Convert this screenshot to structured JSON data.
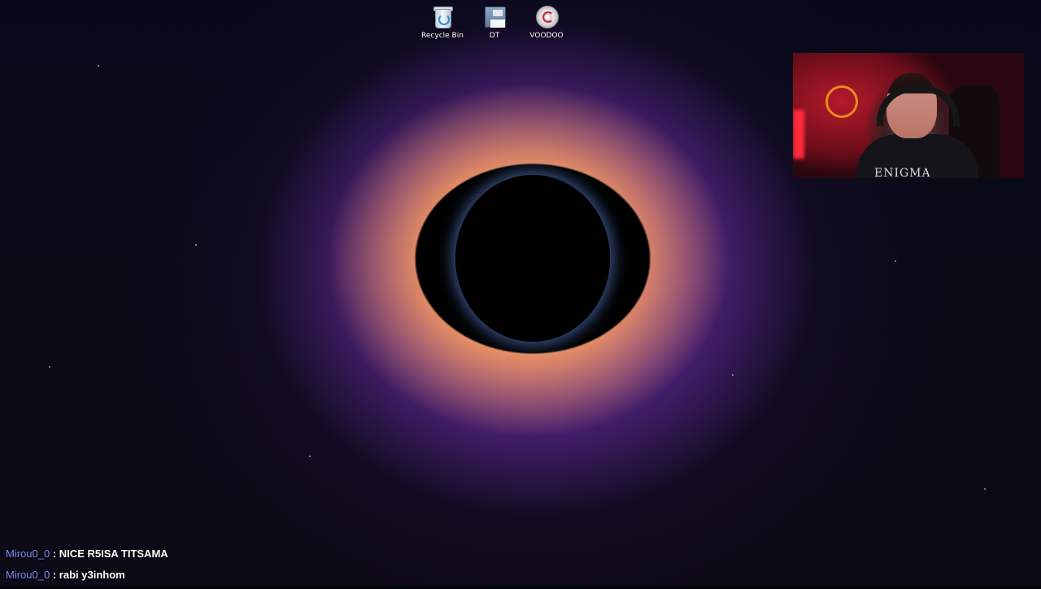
{
  "desktop": {
    "icons": [
      {
        "label": "Recycle Bin",
        "icon": "recycle-bin-icon"
      },
      {
        "label": "DT",
        "icon": "floppy-disk-icon"
      },
      {
        "label": "VOODOO",
        "icon": "disc-icon"
      }
    ]
  },
  "webcam": {
    "shirt_text": "ENIGMA"
  },
  "chat": {
    "messages": [
      {
        "user": "Mirou0_0",
        "separator": ":",
        "text": "NICE R5ISA TITSAMA"
      },
      {
        "user": "Mirou0_0",
        "separator": ":",
        "text": "rabi y3inhom"
      }
    ]
  },
  "colors": {
    "chat_username": "#7d8cf2",
    "chat_text": "#ffffff"
  }
}
